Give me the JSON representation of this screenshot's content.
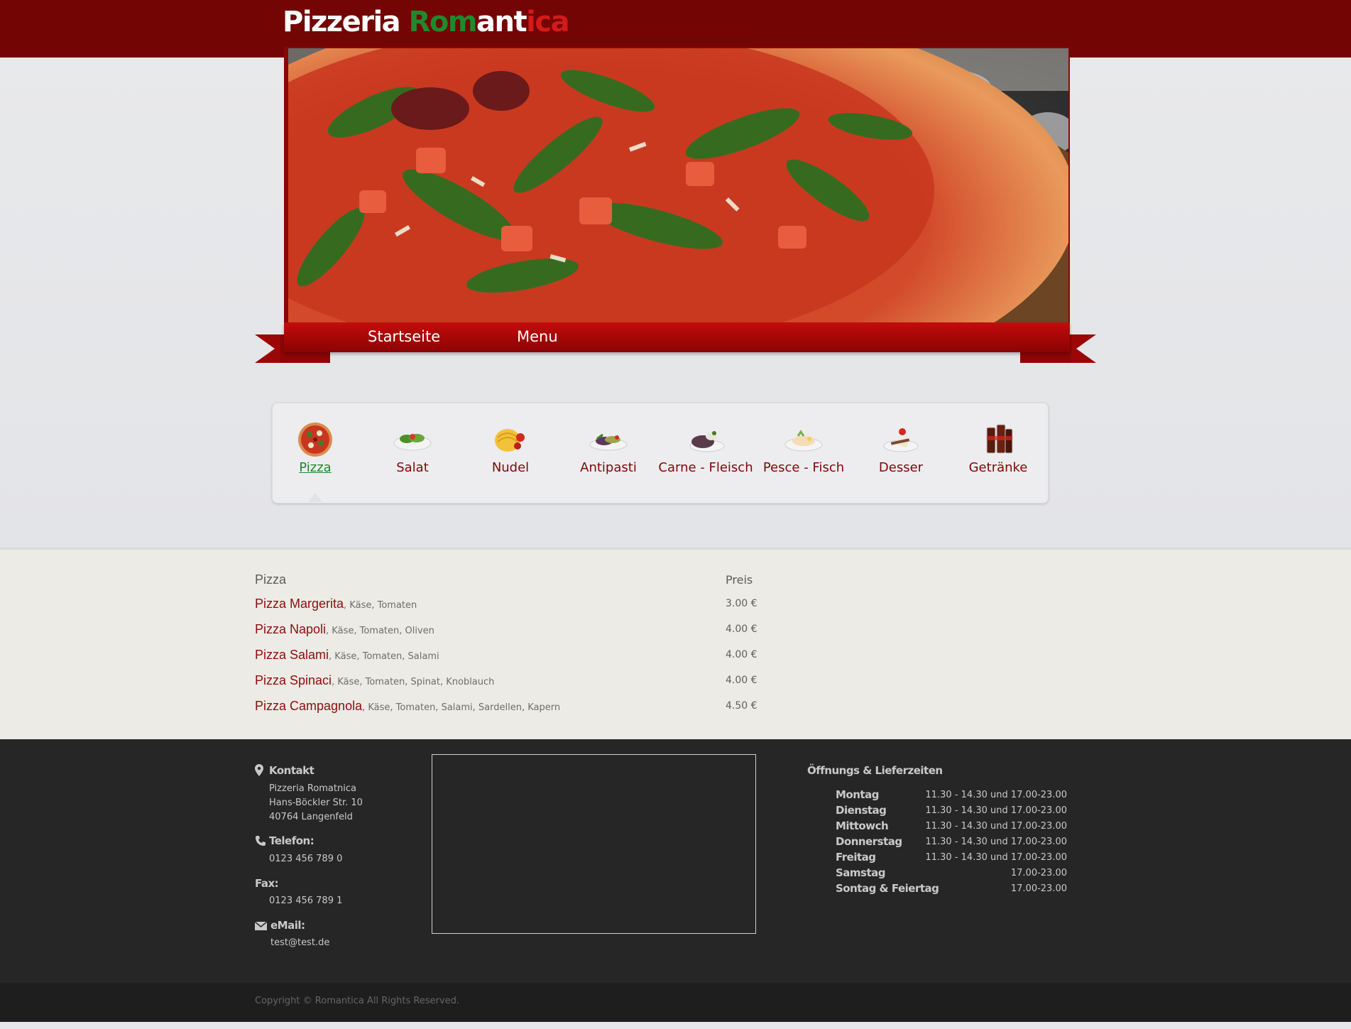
{
  "header": {
    "logo_part1": "Pizzeria ",
    "logo_part2": "Rom",
    "logo_part3": "ant",
    "logo_part4": "ica"
  },
  "nav": {
    "items": [
      {
        "label": "Startseite"
      },
      {
        "label": "Menu"
      }
    ]
  },
  "categories": {
    "active": "Pizza",
    "items": [
      {
        "label": "Pizza",
        "icon": "pizza-icon"
      },
      {
        "label": "Salat",
        "icon": "salad-icon"
      },
      {
        "label": "Nudel",
        "icon": "pasta-icon"
      },
      {
        "label": "Antipasti",
        "icon": "antipasti-icon"
      },
      {
        "label": "Carne - Fleisch",
        "icon": "meat-icon"
      },
      {
        "label": "Pesce - Fisch",
        "icon": "fish-icon"
      },
      {
        "label": "Desser",
        "icon": "dessert-icon"
      },
      {
        "label": "Getränke",
        "icon": "drinks-icon"
      }
    ]
  },
  "menu": {
    "heading": "Pizza",
    "price_heading": "Preis",
    "items": [
      {
        "name": "Pizza Margerita",
        "desc": ", Käse, Tomaten",
        "price": "3.00 €"
      },
      {
        "name": "Pizza Napoli",
        "desc": ", Käse, Tomaten, Oliven",
        "price": "4.00 €"
      },
      {
        "name": "Pizza Salami",
        "desc": ", Käse, Tomaten, Salami",
        "price": "4.00 €"
      },
      {
        "name": "Pizza Spinaci",
        "desc": ", Käse, Tomaten, Spinat, Knoblauch",
        "price": "4.00 €"
      },
      {
        "name": "Pizza Campagnola",
        "desc": ", Käse, Tomaten, Salami, Sardellen, Kapern",
        "price": "4.50 €"
      }
    ]
  },
  "footer": {
    "contact_heading": "Kontakt",
    "address": [
      "Pizzeria Romatnica",
      "Hans-Böckler Str. 10",
      "40764 Langenfeld"
    ],
    "phone_heading": "Telefon:",
    "phone": "0123 456 789 0",
    "fax_heading": "Fax:",
    "fax": "0123 456 789 1",
    "email_heading": "eMail:",
    "email": "test@test.de",
    "hours_heading": "Öffnungs & Lieferzeiten",
    "hours": [
      {
        "day": "Montag",
        "time": "11.30 - 14.30 und 17.00-23.00"
      },
      {
        "day": "Dienstag",
        "time": "11.30 - 14.30 und 17.00-23.00"
      },
      {
        "day": "Mittowch",
        "time": "11.30 - 14.30 und 17.00-23.00"
      },
      {
        "day": "Donnerstag",
        "time": "11.30 - 14.30 und 17.00-23.00"
      },
      {
        "day": "Freitag",
        "time": "11.30 - 14.30 und 17.00-23.00"
      },
      {
        "day": "Samstag",
        "time": "17.00-23.00"
      },
      {
        "day": "Sontag & Feiertag",
        "time": "17.00-23.00"
      }
    ],
    "copyright": "Copyright © Romantica All Rights Reserved."
  },
  "colors": {
    "header_red": "#730505",
    "ribbon_red": "#a80606",
    "active_green": "#1a8a2a",
    "item_red": "#8e0c0c",
    "footer_dark": "#262626"
  }
}
